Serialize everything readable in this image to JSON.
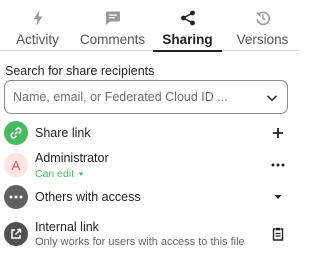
{
  "colors": {
    "accent": "#222222",
    "green": "#46ba61",
    "admin_avatar_bg": "#fde3e3",
    "admin_avatar_fg": "#d15a5a",
    "grey_avatar": "#606060",
    "link_avatar": "#505050"
  },
  "tabs": [
    {
      "label": "Activity",
      "icon": "lightning-icon",
      "active": false
    },
    {
      "label": "Comments",
      "icon": "comment-icon",
      "active": false
    },
    {
      "label": "Sharing",
      "icon": "share-icon",
      "active": true
    },
    {
      "label": "Versions",
      "icon": "history-icon",
      "active": false
    }
  ],
  "search": {
    "heading": "Search for share recipients",
    "placeholder": "Name, email, or Federated Cloud ID ..."
  },
  "share_link": {
    "label": "Share link",
    "icon": "link-icon",
    "action_icon": "plus-icon"
  },
  "administrator": {
    "avatar_letter": "A",
    "name": "Administrator",
    "permission": "Can edit",
    "action_icon": "more-icon"
  },
  "others": {
    "label": "Others with access",
    "icon": "more-icon",
    "action_icon": "caret-down-icon"
  },
  "internal_link": {
    "title": "Internal link",
    "subtitle": "Only works for users with access to this file",
    "icon": "external-link-icon",
    "action_icon": "clipboard-icon"
  }
}
